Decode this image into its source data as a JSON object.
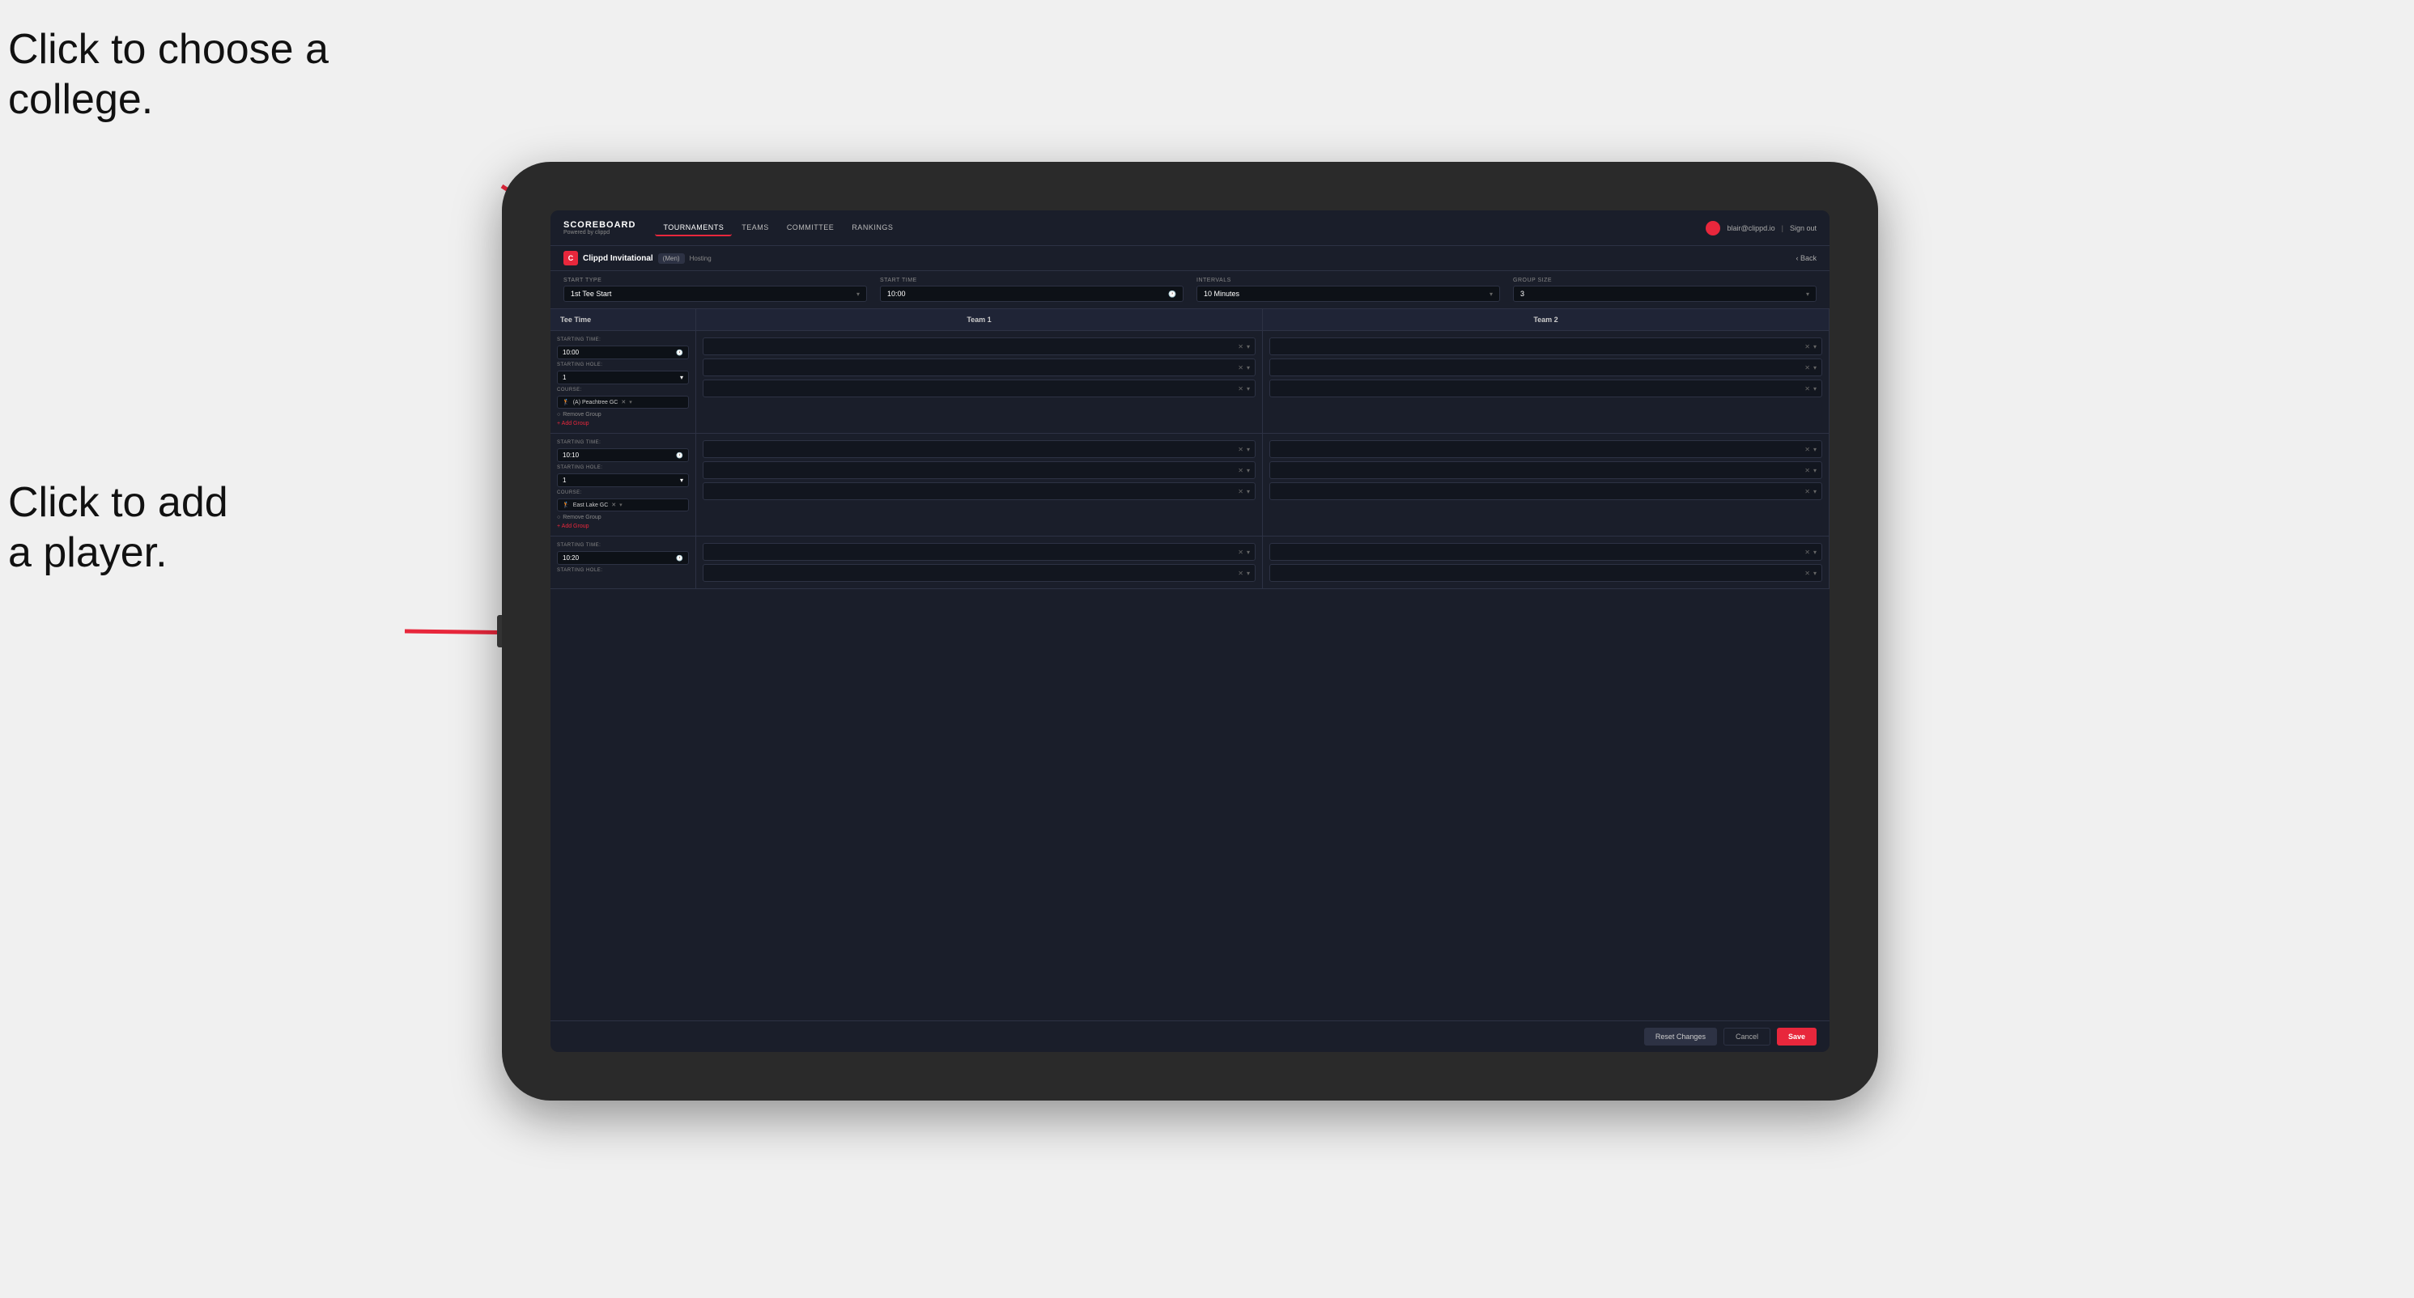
{
  "annotations": {
    "text1_line1": "Click to choose a",
    "text1_line2": "college.",
    "text2_line1": "Click to add",
    "text2_line2": "a player."
  },
  "nav": {
    "brand": "SCOREBOARD",
    "brand_sub": "Powered by clippd",
    "links": [
      "TOURNAMENTS",
      "TEAMS",
      "COMMITTEE",
      "RANKINGS"
    ],
    "active_link": "TOURNAMENTS",
    "user_email": "blair@clippd.io",
    "sign_out": "Sign out"
  },
  "breadcrumb": {
    "event_name": "Clippd Invitational",
    "event_gender": "(Men)",
    "hosting": "Hosting",
    "back_label": "Back"
  },
  "settings": {
    "start_type_label": "Start Type",
    "start_type_value": "1st Tee Start",
    "start_time_label": "Start Time",
    "start_time_value": "10:00",
    "intervals_label": "Intervals",
    "intervals_value": "10 Minutes",
    "group_size_label": "Group Size",
    "group_size_value": "3"
  },
  "table": {
    "col1": "Tee Time",
    "col2": "Team 1",
    "col3": "Team 2"
  },
  "rows": [
    {
      "starting_time": "10:00",
      "starting_hole": "1",
      "course": "(A) Peachtree GC",
      "team1_slots": 2,
      "team2_slots": 2
    },
    {
      "starting_time": "10:10",
      "starting_hole": "1",
      "course": "East Lake GC",
      "team1_slots": 2,
      "team2_slots": 2
    },
    {
      "starting_time": "10:20",
      "starting_hole": "",
      "course": "",
      "team1_slots": 2,
      "team2_slots": 2
    }
  ],
  "controls": {
    "remove_group": "Remove Group",
    "add_group": "+ Add Group"
  },
  "footer": {
    "reset_label": "Reset Changes",
    "cancel_label": "Cancel",
    "save_label": "Save"
  }
}
